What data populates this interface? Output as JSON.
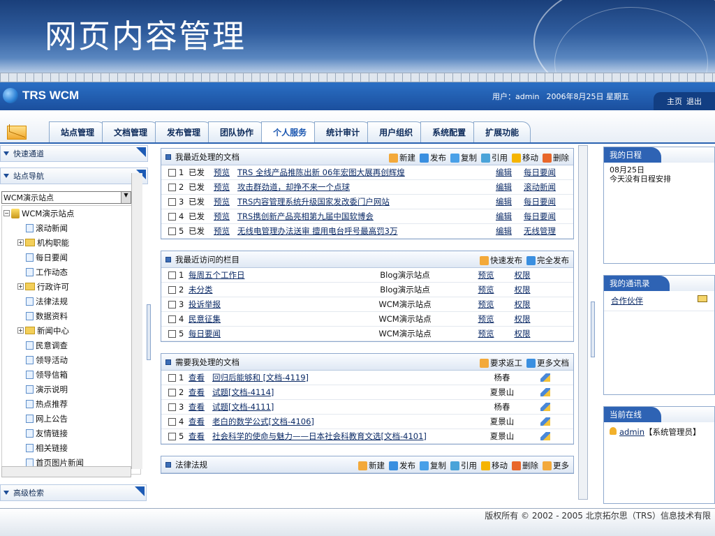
{
  "slide": {
    "title": "网页内容管理"
  },
  "header": {
    "brand": "TRS WCM",
    "user_label": "用户：admin",
    "date": "2006年8月25日 星期五",
    "home_link": "主页",
    "logout_link": "退出"
  },
  "nav": {
    "tabs": [
      "站点管理",
      "文档管理",
      "发布管理",
      "团队协作",
      "个人服务",
      "统计审计",
      "用户组织",
      "系统配置",
      "扩展功能"
    ],
    "active_index": 4
  },
  "sidebar": {
    "quick_channel": "快速通道",
    "site_nav": "站点导航",
    "site_select": "WCM演示站点",
    "tree": [
      {
        "label": "WCM演示站点",
        "type": "site",
        "level": 0,
        "toggle": "−"
      },
      {
        "label": "滚动新闻",
        "type": "page",
        "level": 1,
        "toggle": ""
      },
      {
        "label": "机构职能",
        "type": "folder",
        "level": 1,
        "toggle": "+"
      },
      {
        "label": "每日要闻",
        "type": "page",
        "level": 1,
        "toggle": ""
      },
      {
        "label": "工作动态",
        "type": "page",
        "level": 1,
        "toggle": ""
      },
      {
        "label": "行政许可",
        "type": "folder",
        "level": 1,
        "toggle": "+"
      },
      {
        "label": "法律法规",
        "type": "page",
        "level": 1,
        "toggle": ""
      },
      {
        "label": "数据资料",
        "type": "page",
        "level": 1,
        "toggle": ""
      },
      {
        "label": "新闻中心",
        "type": "folder",
        "level": 1,
        "toggle": "+"
      },
      {
        "label": "民意调查",
        "type": "page",
        "level": 1,
        "toggle": ""
      },
      {
        "label": "领导活动",
        "type": "page",
        "level": 1,
        "toggle": ""
      },
      {
        "label": "领导信箱",
        "type": "page",
        "level": 1,
        "toggle": ""
      },
      {
        "label": "演示说明",
        "type": "page",
        "level": 1,
        "toggle": ""
      },
      {
        "label": "热点推荐",
        "type": "page",
        "level": 1,
        "toggle": ""
      },
      {
        "label": "网上公告",
        "type": "page",
        "level": 1,
        "toggle": ""
      },
      {
        "label": "友情链接",
        "type": "page",
        "level": 1,
        "toggle": ""
      },
      {
        "label": "相关链接",
        "type": "page",
        "level": 1,
        "toggle": ""
      },
      {
        "label": "首页图片新闻",
        "type": "page",
        "level": 1,
        "toggle": ""
      }
    ],
    "advanced_search": "高级检索"
  },
  "recent_docs": {
    "title": "我最近处理的文档",
    "actions": [
      "新建",
      "发布",
      "复制",
      "引用",
      "移动",
      "删除"
    ],
    "rows": [
      {
        "n": "1",
        "status": "已发",
        "preview": "预览",
        "title": "TRS 全线产品推陈出新 06年宏图大展再创辉煌",
        "edit": "编辑",
        "channel": "每日要闻"
      },
      {
        "n": "2",
        "status": "已发",
        "preview": "预览",
        "title": "攻击群劲道，却挣不来一个点球",
        "edit": "编辑",
        "channel": "滚动新闻"
      },
      {
        "n": "3",
        "status": "已发",
        "preview": "预览",
        "title": "TRS内容管理系统升级国家发改委门户网站",
        "edit": "编辑",
        "channel": "每日要闻"
      },
      {
        "n": "4",
        "status": "已发",
        "preview": "预览",
        "title": "TRS携创新产品亮相第九届中国软博会",
        "edit": "编辑",
        "channel": "每日要闻"
      },
      {
        "n": "5",
        "status": "已发",
        "preview": "预览",
        "title": "无线电管理办法送审 擅用电台呼号最高罚3万",
        "edit": "编辑",
        "channel": "无线管理"
      }
    ]
  },
  "recent_columns": {
    "title": "我最近访问的栏目",
    "actions": [
      "快速发布",
      "完全发布"
    ],
    "rows": [
      {
        "n": "1",
        "name": "每周五个工作日",
        "site": "Blog演示站点",
        "preview": "预览",
        "perm": "权限"
      },
      {
        "n": "2",
        "name": "未分类",
        "site": "Blog演示站点",
        "preview": "预览",
        "perm": "权限"
      },
      {
        "n": "3",
        "name": "投诉举报",
        "site": "WCM演示站点",
        "preview": "预览",
        "perm": "权限"
      },
      {
        "n": "4",
        "name": "民意征集",
        "site": "WCM演示站点",
        "preview": "预览",
        "perm": "权限"
      },
      {
        "n": "5",
        "name": "每日要闻",
        "site": "WCM演示站点",
        "preview": "预览",
        "perm": "权限"
      }
    ]
  },
  "todo_docs": {
    "title": "需要我处理的文档",
    "actions": [
      "要求返工",
      "更多文档"
    ],
    "rows": [
      {
        "n": "1",
        "view": "查看",
        "title": "回归后能够和 [文档-4119]",
        "person": "杨春"
      },
      {
        "n": "2",
        "view": "查看",
        "title": "试题[文档-4114]",
        "person": "夏景山"
      },
      {
        "n": "3",
        "view": "查看",
        "title": "试题[文档-4111]",
        "person": "杨春"
      },
      {
        "n": "4",
        "view": "查看",
        "title": "老白的数学公式[文档-4106]",
        "person": "夏景山"
      },
      {
        "n": "5",
        "view": "查看",
        "title": "社会科学的使命与魅力——日本社会科教育文选[文档-4101]",
        "person": "夏景山"
      }
    ]
  },
  "law_panel": {
    "title": "法律法规",
    "actions": [
      "新建",
      "发布",
      "复制",
      "引用",
      "移动",
      "删除",
      "更多"
    ]
  },
  "right": {
    "schedule": {
      "title": "我的日程",
      "date": "08月25日",
      "text": "今天没有日程安排"
    },
    "contacts": {
      "title": "我的通讯录",
      "item": "合作伙伴"
    },
    "online": {
      "title": "当前在线",
      "user": "admin",
      "role": "【系统管理员】"
    }
  },
  "footer": {
    "copyright": "版权所有 © 2002 - 2005 北京拓尔思（TRS）信息技术有限"
  }
}
